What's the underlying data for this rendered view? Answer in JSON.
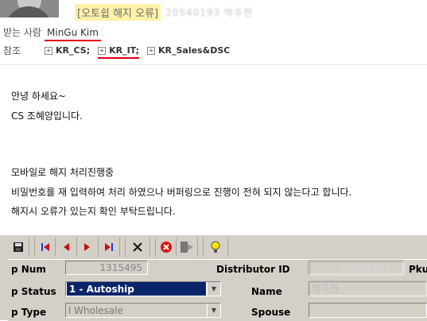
{
  "email": {
    "subject_tag": "[오토쉽 해지 오류]",
    "subject_suffix": "20540193 박주현",
    "to_label": "받는 사람",
    "to_name": "MinGu Kim",
    "cc_label": "참조",
    "cc": [
      "KR_CS;",
      "KR_IT;",
      "KR_Sales&DSC"
    ]
  },
  "body": {
    "greeting": "안녕 하세요~",
    "intro": "CS 조혜양입니다.",
    "line1": "모바일로 해지 처리진행중",
    "line2": "비밀번호를 재 입력하여 처리 하였으나 버퍼링으로 진행이 전혀 되지 않는다고 합니다.",
    "line3": "해지시 오류가 있는지 확인 부탁드립니다."
  },
  "app": {
    "toolbar": [
      "save-icon",
      "first-record-icon",
      "previous-record-icon",
      "next-record-icon",
      "last-record-icon",
      "delete-icon",
      "cancel-icon",
      "exit-icon",
      "help-icon"
    ],
    "fields": {
      "num_label": "p Num",
      "num_value": "1315495",
      "distributor_label": "Distributor ID",
      "distributor_value": "20540193",
      "pku_label": "Pku",
      "status_label": "p Status",
      "status_value": "1 - Autoship",
      "name_label": "Name",
      "name_value": "박주현",
      "type_label": "p Type",
      "type_value": "l Wholesale",
      "spouse_label": "Spouse"
    }
  }
}
